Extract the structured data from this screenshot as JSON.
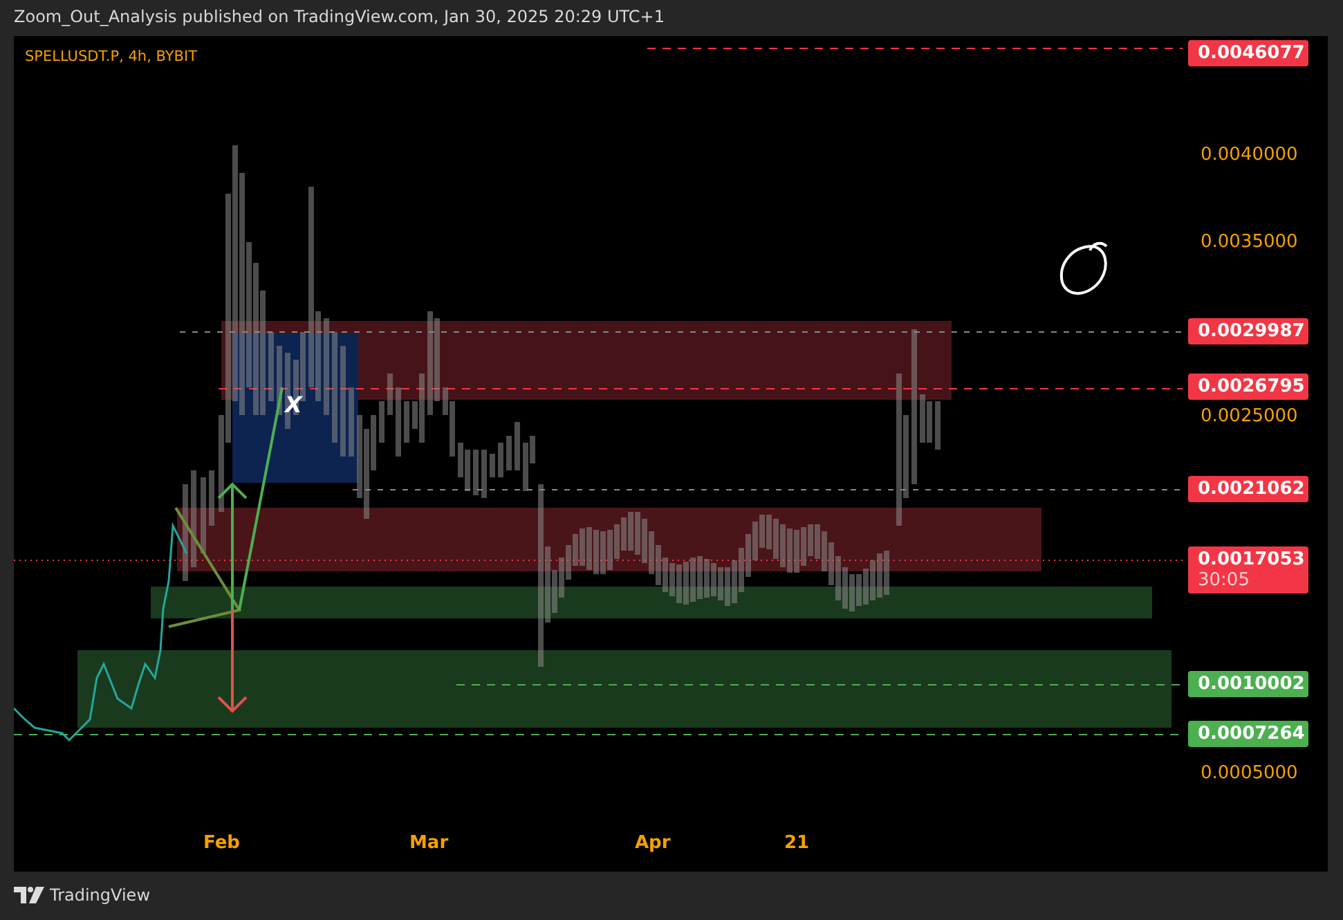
{
  "header": {
    "text": "Zoom_Out_Analysis published on TradingView.com, Jan 30, 2025 20:29 UTC+1"
  },
  "chart": {
    "symbol": "SPELLUSDT.P, 4h, BYBIT",
    "marker_label": "X",
    "price_axis": [
      {
        "kind": "tag",
        "label": "0.0046077",
        "color": "#f23645"
      },
      {
        "kind": "tick",
        "label": "0.0040000"
      },
      {
        "kind": "tick",
        "label": "0.0035000"
      },
      {
        "kind": "tag",
        "label": "0.0029987",
        "color": "#f23645"
      },
      {
        "kind": "tag",
        "label": "0.0026795",
        "color": "#f23645"
      },
      {
        "kind": "tick",
        "label": "0.0025000"
      },
      {
        "kind": "tag",
        "label": "0.0021062",
        "color": "#f23645"
      },
      {
        "kind": "tag",
        "label": "0.0017053",
        "countdown": "30:05",
        "color": "#f23645"
      },
      {
        "kind": "tag",
        "label": "0.0010002",
        "color": "#4caf50"
      },
      {
        "kind": "tag",
        "label": "0.0007264",
        "color": "#4caf50"
      },
      {
        "kind": "tick",
        "label": "0.0005000"
      }
    ],
    "time_axis": [
      "Feb",
      "Mar",
      "Apr",
      "21"
    ]
  },
  "footer": {
    "brand": "TradingView"
  }
}
